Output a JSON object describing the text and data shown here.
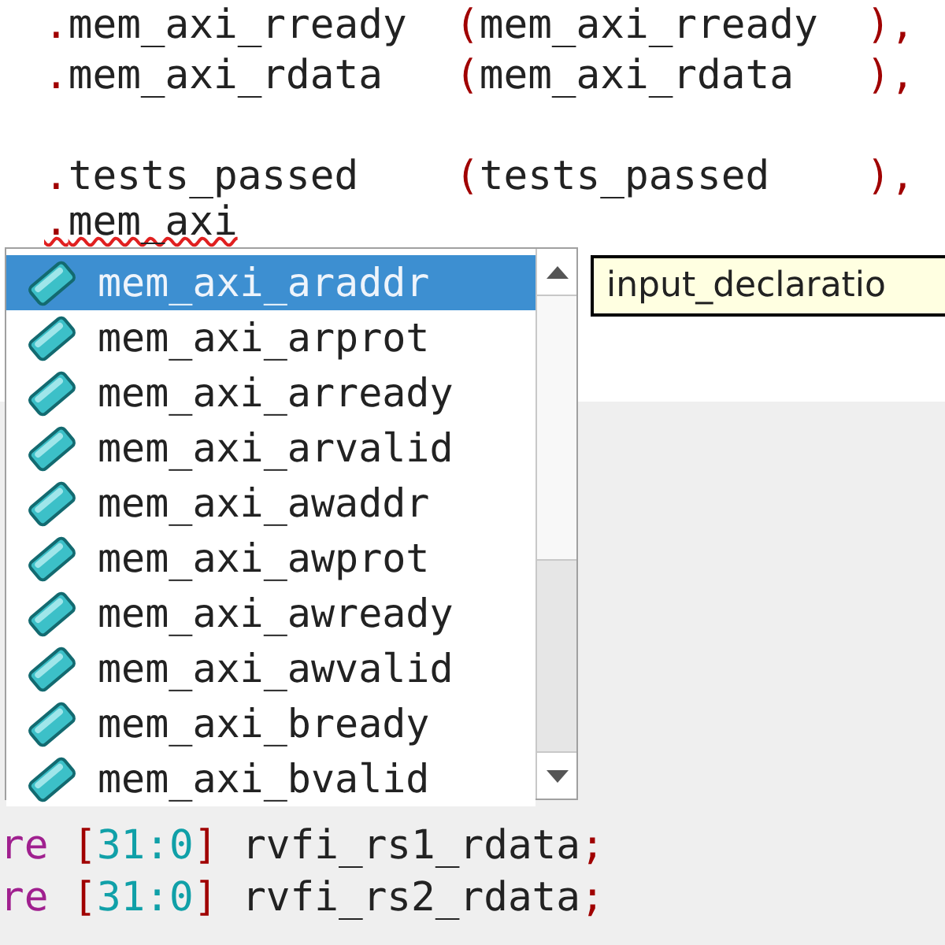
{
  "editor": {
    "blocks": [
      [
        {
          "segments": [
            {
              "kind": "punct",
              "text": "."
            },
            {
              "kind": "plain",
              "text": "mem_axi_rready  "
            },
            {
              "kind": "punct",
              "text": "("
            },
            {
              "kind": "plain",
              "text": "mem_axi_rready  "
            },
            {
              "kind": "punct",
              "text": "),"
            }
          ]
        },
        {
          "segments": [
            {
              "kind": "punct",
              "text": "."
            },
            {
              "kind": "plain",
              "text": "mem_axi_rdata   "
            },
            {
              "kind": "punct",
              "text": "("
            },
            {
              "kind": "plain",
              "text": "mem_axi_rdata   "
            },
            {
              "kind": "punct",
              "text": "),"
            }
          ]
        }
      ],
      [
        {
          "segments": [
            {
              "kind": "punct",
              "text": "."
            },
            {
              "kind": "plain",
              "text": "tests_passed    "
            },
            {
              "kind": "punct",
              "text": "("
            },
            {
              "kind": "plain",
              "text": "tests_passed    "
            },
            {
              "kind": "punct",
              "text": "),"
            }
          ]
        },
        {
          "misspelled": true,
          "segments": [
            {
              "kind": "punct",
              "text": "."
            },
            {
              "kind": "plain",
              "text": "mem_axi"
            }
          ]
        }
      ]
    ],
    "lower_lines": [
      {
        "segments": [
          {
            "kind": "keyword",
            "text": "re"
          },
          {
            "kind": "punct",
            "text": " ["
          },
          {
            "kind": "number",
            "text": "31:0"
          },
          {
            "kind": "punct",
            "text": "]"
          },
          {
            "kind": "plain",
            "text": " rvfi_rs1_rdata"
          },
          {
            "kind": "punct",
            "text": ";"
          }
        ]
      },
      {
        "segments": [
          {
            "kind": "keyword",
            "text": "re"
          },
          {
            "kind": "punct",
            "text": " ["
          },
          {
            "kind": "number",
            "text": "31:0"
          },
          {
            "kind": "punct",
            "text": "]"
          },
          {
            "kind": "plain",
            "text": " rvfi_rs2_rdata"
          },
          {
            "kind": "punct",
            "text": ";"
          }
        ]
      }
    ]
  },
  "autocomplete": {
    "items": [
      {
        "label": "mem_axi_araddr",
        "selected": true
      },
      {
        "label": "mem_axi_arprot",
        "selected": false
      },
      {
        "label": "mem_axi_arready",
        "selected": false
      },
      {
        "label": "mem_axi_arvalid",
        "selected": false
      },
      {
        "label": "mem_axi_awaddr",
        "selected": false
      },
      {
        "label": "mem_axi_awprot",
        "selected": false
      },
      {
        "label": "mem_axi_awready",
        "selected": false
      },
      {
        "label": "mem_axi_awvalid",
        "selected": false
      },
      {
        "label": "mem_axi_bready",
        "selected": false
      },
      {
        "label": "mem_axi_bvalid",
        "selected": false
      }
    ]
  },
  "tooltip": {
    "text": "input_declaratio"
  }
}
